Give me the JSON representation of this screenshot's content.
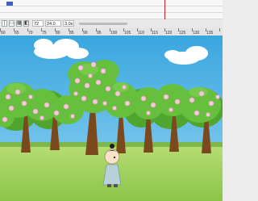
{
  "timeline": {
    "frame": "72",
    "fps": "24.0 fps",
    "time": "3.0s"
  },
  "toolbar_icons": [
    "onion-skin-icon",
    "onion-outline-icon",
    "edit-multiple-icon",
    "onion-markers-icon"
  ],
  "ruler": {
    "labels": [
      "60",
      "65",
      "70",
      "75",
      "80",
      "85",
      "90",
      "95",
      "100",
      "105",
      "110",
      "115",
      "120",
      "125",
      "130",
      "135"
    ]
  },
  "colors": {
    "sky": "#5ab8e6",
    "ground": "#9ccc54",
    "blossom": "#f4c6dc",
    "foliage": "#5fb83a",
    "trunk": "#7a4a1e",
    "playhead": "#cc2222"
  },
  "stage": {
    "scene": "cherry blossom park with boy character"
  }
}
